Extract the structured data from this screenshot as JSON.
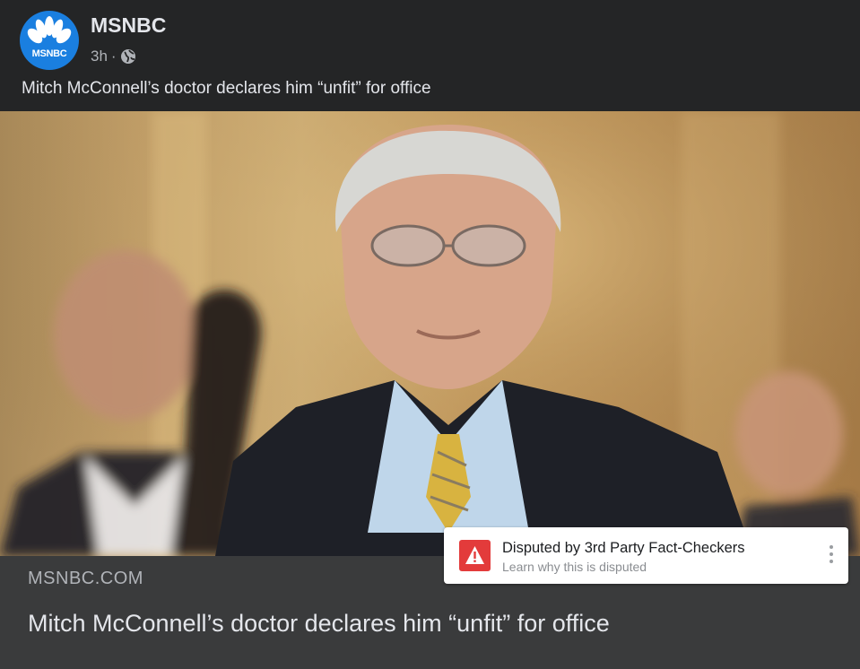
{
  "post": {
    "page_name": "MSNBC",
    "avatar_label": "MSNBC",
    "timestamp": "3h",
    "separator": "·",
    "visibility_icon": "globe-icon",
    "text": "Mitch McConnell’s doctor declares him “unfit” for office"
  },
  "link_preview": {
    "domain": "MSNBC.COM",
    "title": "Mitch McConnell’s doctor declares him “unfit” for office"
  },
  "dispute_notice": {
    "icon": "warning-icon",
    "title": "Disputed by 3rd Party Fact-Checkers",
    "subtitle": "Learn why this is disputed",
    "menu_icon": "more-options-icon",
    "accent_color": "#e33b3b"
  },
  "colors": {
    "background": "#242526",
    "link_bar": "#3a3b3c",
    "brand_blue": "#1a7fe0"
  }
}
